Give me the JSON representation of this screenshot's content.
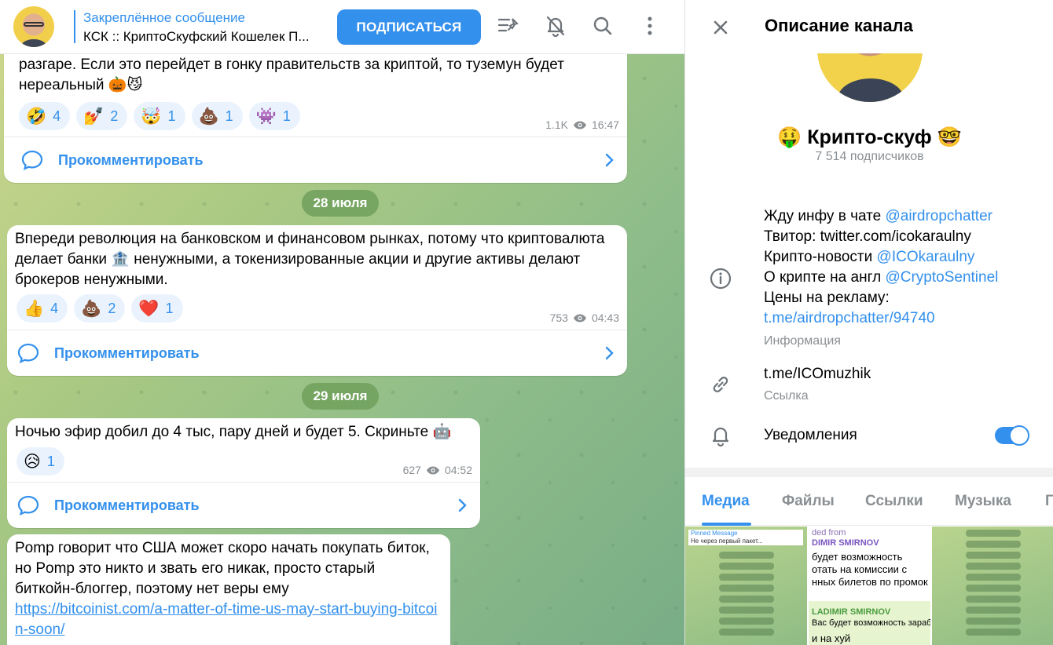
{
  "header": {
    "pinned_title": "Закреплённое сообщение",
    "pinned_text": "КСК :: КриптоСкуфский Кошелек П...",
    "subscribe_label": "ПОДПИСАТЬСЯ"
  },
  "messages": [
    {
      "text": "разгаре. Если это перейдет в гонку правительств за криптой, то туземун будет нереальный 🎃😼",
      "reactions": [
        {
          "emoji": "🤣",
          "count": "4"
        },
        {
          "emoji": "💅",
          "count": "2"
        },
        {
          "emoji": "🤯",
          "count": "1"
        },
        {
          "emoji": "💩",
          "count": "1"
        },
        {
          "emoji": "👾",
          "count": "1"
        }
      ],
      "views": "1.1K",
      "time": "16:47",
      "comment_label": "Прокомментировать"
    },
    {
      "date": "28 июля",
      "text": "Впереди революция на банковском и финансовом рынках, потому что криптовалюта делает банки 🏦 ненужными, а токенизированные акции и другие активы делают брокеров ненужными.",
      "reactions": [
        {
          "emoji": "👍",
          "count": "4"
        },
        {
          "emoji": "💩",
          "count": "2"
        },
        {
          "emoji": "❤️",
          "count": "1"
        }
      ],
      "views": "753",
      "time": "04:43",
      "comment_label": "Прокомментировать"
    },
    {
      "date": "29 июля",
      "text": "Ночью эфир добил до 4 тыс, пару дней и будет 5. Скриньте 🤖",
      "reactions": [
        {
          "emoji": "😥",
          "count": "1"
        }
      ],
      "views": "627",
      "time": "04:52",
      "comment_label": "Прокомментировать"
    },
    {
      "text": "Pomp говорит что США может скоро начать покупать биток, но Pomp это никто и звать его никак, просто старый биткойн-блоггер, поэтому нет веры ему",
      "link": "https://bitcoinist.com/a-matter-of-time-us-may-start-buying-bitcoin-soon/"
    }
  ],
  "panel": {
    "title": "Описание канала",
    "channel_name": "🤑 Крипто-скуф 🤓",
    "subscribers": "7 514 подписчиков",
    "info_lines": [
      {
        "prefix": "Жду инфу в чате ",
        "link": "@airdropchatter"
      },
      {
        "prefix": "Твитор: twitter.com/icokaraulny",
        "link": ""
      },
      {
        "prefix": "Крипто-новости ",
        "link": "@ICOkaraulny"
      },
      {
        "prefix": "О крипте на англ ",
        "link": "@CryptoSentinel"
      },
      {
        "prefix": "Цены на рекламу:",
        "link": ""
      },
      {
        "prefix": "",
        "link": "t.me/airdropchatter/94740"
      }
    ],
    "info_label": "Информация",
    "link_value": "t.me/ICOmuzhik",
    "link_label": "Ссылка",
    "notifications_label": "Уведомления",
    "notifications_on": true,
    "tabs": [
      "Медиа",
      "Файлы",
      "Ссылки",
      "Музыка",
      "Г"
    ],
    "thumb2_lines": [
      "ded from",
      "DIMIR SMIRNOV",
      "будет возможность",
      "отать на комиссии с",
      "нных билетов по промок",
      "LADIMIR SMIRNOV",
      "Вас будет возможность заработ",
      "и на хуй"
    ],
    "thumb1_top": [
      "Pinned Message",
      "Не через первый пакет..."
    ]
  },
  "colors": {
    "accent": "#3390ec"
  }
}
